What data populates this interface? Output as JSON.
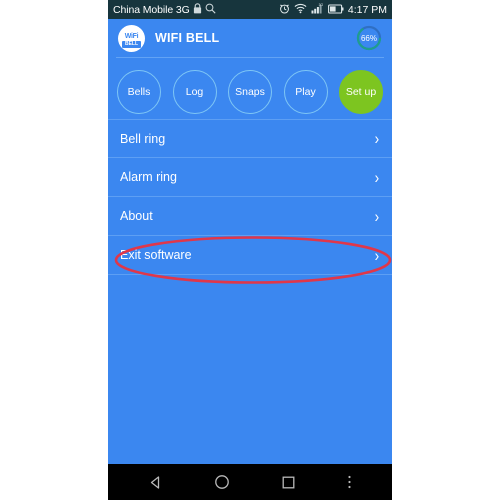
{
  "status_bar": {
    "carrier": "China Mobile 3G",
    "lock_icon": "lock-icon",
    "search_icon": "search-icon",
    "alarm_icon": "alarm-clock-icon",
    "wifi_icon": "wifi-icon",
    "signal_icon": "cell-signal-icon",
    "battery_icon": "battery-icon",
    "time": "4:17 PM"
  },
  "app_bar": {
    "logo_top_text": "WiFi",
    "logo_bottom_text": "BELL",
    "title": "WIFI BELL",
    "battery_percent_label": "66%",
    "battery_percent_value": 66
  },
  "circle_buttons": [
    {
      "label": "Bells",
      "active": false
    },
    {
      "label": "Log",
      "active": false
    },
    {
      "label": "Snaps",
      "active": false
    },
    {
      "label": "Play",
      "active": false
    },
    {
      "label": "Set up",
      "active": true
    }
  ],
  "menu_rows": [
    {
      "label": "Bell ring",
      "chevron": "›"
    },
    {
      "label": "Alarm ring",
      "chevron": "›"
    },
    {
      "label": "About",
      "chevron": "›"
    },
    {
      "label": "Exit software",
      "chevron": "›"
    }
  ],
  "annotation": {
    "shape": "ellipse",
    "target_label": "Exit software",
    "color": "#e0374a"
  },
  "nav_bar": {
    "back_icon": "back-triangle-icon",
    "home_icon": "home-circle-icon",
    "recents_icon": "recents-square-icon",
    "overflow_icon": "overflow-menu-icon"
  },
  "colors": {
    "screen_background": "#3b87f0",
    "status_bar": "#17353d",
    "accent_green": "#7dc520",
    "circle_outline": "#7ec6f5",
    "divider": "#5d9ff4",
    "annotation_red": "#e0374a",
    "nav_bar": "#000000",
    "page_background": "#ffffff"
  }
}
